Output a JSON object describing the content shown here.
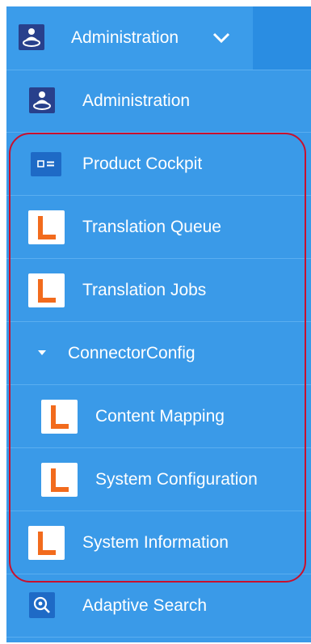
{
  "header": {
    "title": "Administration",
    "icon": "admin-user-icon",
    "chevron": "chevron-down-icon"
  },
  "menu": {
    "items": [
      {
        "label": "Administration",
        "icon": "admin-user-icon"
      },
      {
        "label": "Product Cockpit",
        "icon": "product-cockpit-icon"
      },
      {
        "label": "Translation Queue",
        "icon": "l-logo-icon"
      },
      {
        "label": "Translation Jobs",
        "icon": "l-logo-icon"
      },
      {
        "label": "ConnectorConfig",
        "icon": "expand-triangle-icon"
      },
      {
        "label": "Content Mapping",
        "icon": "l-logo-icon"
      },
      {
        "label": "System Configuration",
        "icon": "l-logo-icon"
      },
      {
        "label": "System Information",
        "icon": "l-logo-icon"
      },
      {
        "label": "Adaptive Search",
        "icon": "adaptive-search-icon"
      }
    ]
  },
  "colors": {
    "panel_background": "#3a9ae8",
    "header_accent": "#2a8de2",
    "admin_icon_background": "#28408c",
    "cockpit_icon_background": "#1e6ac6",
    "logo_orange": "#f26b1d",
    "highlight_outline": "#c8102e",
    "text": "#ffffff"
  }
}
